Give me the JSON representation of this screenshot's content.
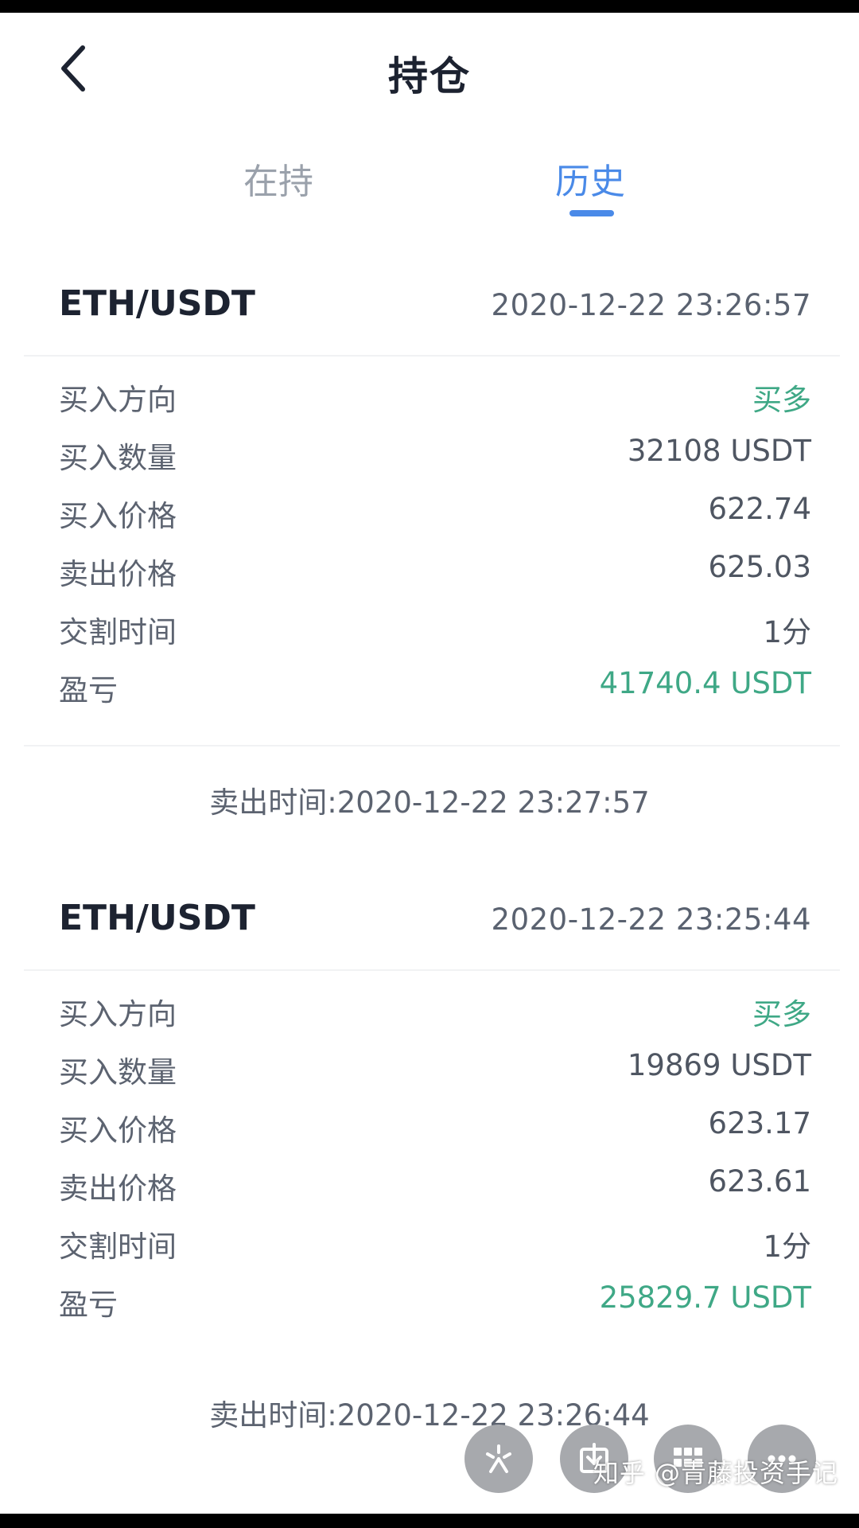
{
  "header": {
    "title": "持仓"
  },
  "tabs": [
    {
      "label": "在持",
      "active": false
    },
    {
      "label": "历史",
      "active": true
    }
  ],
  "colors": {
    "accent": "#4a8ae8",
    "profit_green": "#3fa886",
    "text_dark": "#1d2331",
    "text_muted": "#5c6370"
  },
  "trades": [
    {
      "pair": "ETH/USDT",
      "open_time": "2020-12-22 23:26:57",
      "rows": [
        {
          "label": "买入方向",
          "value": "买多"
        },
        {
          "label": "买入数量",
          "value": "32108 USDT"
        },
        {
          "label": "买入价格",
          "value": "622.74"
        },
        {
          "label": "卖出价格",
          "value": "625.03"
        },
        {
          "label": "交割时间",
          "value": "1分"
        },
        {
          "label": "盈亏",
          "value": "41740.4 USDT"
        }
      ],
      "sell_time": "卖出时间:2020-12-22 23:27:57"
    },
    {
      "pair": "ETH/USDT",
      "open_time": "2020-12-22 23:25:44",
      "rows": [
        {
          "label": "买入方向",
          "value": "买多"
        },
        {
          "label": "买入数量",
          "value": "19869 USDT"
        },
        {
          "label": "买入价格",
          "value": "623.17"
        },
        {
          "label": "卖出价格",
          "value": "623.61"
        },
        {
          "label": "交割时间",
          "value": "1分"
        },
        {
          "label": "盈亏",
          "value": "25829.7 USDT"
        }
      ],
      "sell_time": "卖出时间:2020-12-22 23:26:44"
    }
  ],
  "floating_buttons": [
    {
      "icon": "sparkle-icon"
    },
    {
      "icon": "download-icon"
    },
    {
      "icon": "grid-icon"
    },
    {
      "icon": "more-icon"
    }
  ],
  "watermark": "知乎 @青藤投资手记"
}
